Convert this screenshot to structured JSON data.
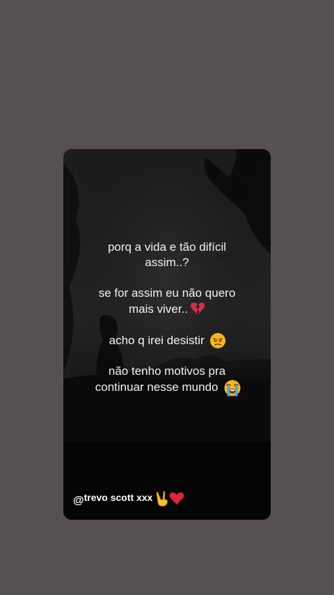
{
  "story": {
    "lines": {
      "l1": "porq a vida e tão difícil",
      "l2": "assim..?",
      "l3": "se for assim eu não quero",
      "l4": "mais viver..",
      "l5": "acho q irei desistir",
      "l6": "não tenho motivos pra",
      "l7": "continuar nesse mundo"
    },
    "icons": {
      "broken_heart": "broken-heart-icon",
      "disappointed": "disappointed-face-icon",
      "crying": "loudly-crying-face-icon"
    }
  },
  "sticker": {
    "at": "@",
    "handle": "trevo scott xxx",
    "icons": [
      "victory-hand-icon",
      "red-heart-icon"
    ]
  },
  "colors": {
    "background": "#575051",
    "card": "#101010",
    "text": "#f2f2f2"
  }
}
